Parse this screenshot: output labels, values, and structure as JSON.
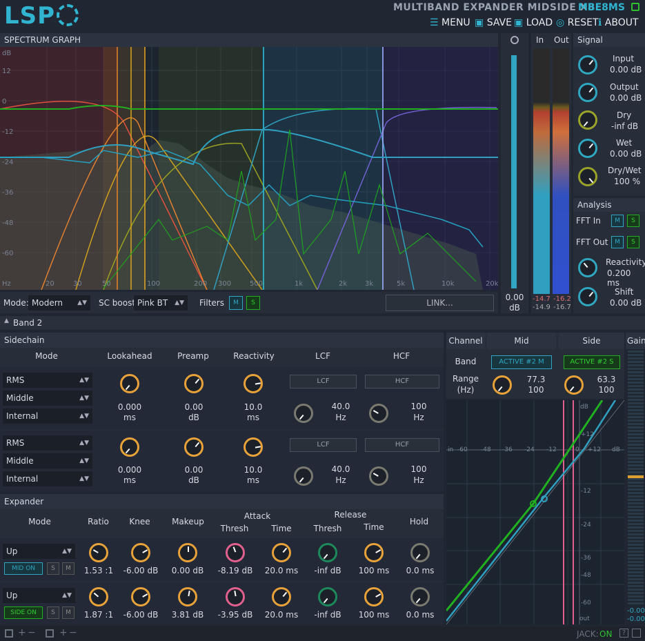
{
  "header": {
    "logo": "LSP",
    "title": "MULTIBAND EXPANDER MIDSIDE X8",
    "short": "MBE8MS",
    "menu": [
      "MENU",
      "SAVE",
      "LOAD",
      "RESET",
      "ABOUT"
    ]
  },
  "spectrum": {
    "title": "SPECTRUM GRAPH",
    "unit": "dB",
    "ylabels": [
      "12",
      "0",
      "-12",
      "-24",
      "-36",
      "-48",
      "-60"
    ],
    "xlabels": [
      "Hz",
      "20",
      "30",
      "50",
      "100",
      "200",
      "300",
      "500",
      "1k",
      "2k",
      "3k",
      "5k",
      "10k",
      "20k"
    ],
    "zoom_value": "0.00",
    "zoom_unit": "dB"
  },
  "meters": {
    "in_label": "In",
    "out_label": "Out",
    "in_vals": [
      "-14.7",
      "-14.9"
    ],
    "out_vals": [
      "-16.2",
      "-16.7"
    ]
  },
  "signal": {
    "title": "Signal",
    "rows": [
      {
        "label": "Input",
        "value": "0.00 dB"
      },
      {
        "label": "Output",
        "value": "0.00 dB"
      },
      {
        "label": "Dry",
        "value": "-inf dB"
      },
      {
        "label": "Wet",
        "value": "0.00 dB"
      },
      {
        "label": "Dry/Wet",
        "value": "100 %"
      }
    ]
  },
  "analysis": {
    "title": "Analysis",
    "fft_in": "FFT In",
    "fft_out": "FFT Out",
    "m": "M",
    "s": "S",
    "reactivity_label": "Reactivity",
    "reactivity_value": "0.200 ms",
    "shift_label": "Shift",
    "shift_value": "0.00 dB"
  },
  "controls": {
    "mode_label": "Mode:",
    "mode_value": "Modern",
    "scboost_label": "SC boost:",
    "scboost_value": "Pink BT",
    "filters_label": "Filters",
    "m": "M",
    "s": "S",
    "link": "LINK..."
  },
  "band": {
    "label": "Band 2"
  },
  "sidechain": {
    "title": "Sidechain",
    "cols": [
      "Mode",
      "Lookahead",
      "Preamp",
      "Reactivity",
      "LCF",
      "HCF"
    ],
    "rows": [
      {
        "mode": "RMS",
        "source": "Middle",
        "type": "Internal",
        "lookahead": "0.000",
        "la_unit": "ms",
        "preamp": "0.00",
        "pre_unit": "dB",
        "react": "10.0",
        "react_unit": "ms",
        "lcf": "LCF",
        "hcf": "HCF",
        "lcf_val": "40.0",
        "lcf_unit": "Hz",
        "hcf_val": "100",
        "hcf_unit": "Hz"
      },
      {
        "mode": "RMS",
        "source": "Middle",
        "type": "Internal",
        "lookahead": "0.000",
        "la_unit": "ms",
        "preamp": "0.00",
        "pre_unit": "dB",
        "react": "10.0",
        "react_unit": "ms",
        "lcf": "LCF",
        "hcf": "HCF",
        "lcf_val": "40.0",
        "lcf_unit": "Hz",
        "hcf_val": "100",
        "hcf_unit": "Hz"
      }
    ]
  },
  "channel": {
    "title": "Channel",
    "mid": "Mid",
    "side": "Side",
    "band_label": "Band",
    "range_label": "Range",
    "range_unit": "(Hz)",
    "mid_btn": "ACTIVE #2 M",
    "side_btn": "ACTIVE #2 S",
    "mid_range": [
      "77.3",
      "100"
    ],
    "side_range": [
      "63.3",
      "100"
    ]
  },
  "gain": {
    "label": "Gain",
    "vals": [
      "-0.00",
      "-0.00"
    ]
  },
  "expander": {
    "title": "Expander",
    "cols": [
      "Mode",
      "Ratio",
      "Knee",
      "Makeup",
      "Attack",
      "Release",
      "Hold"
    ],
    "sub": [
      "Thresh",
      "Time",
      "Thresh",
      "Time"
    ],
    "rows": [
      {
        "mode": "Up",
        "on": "MID ON",
        "s": "S",
        "m": "M",
        "ratio": "1.53 :1",
        "knee": "-6.00 dB",
        "makeup": "0.00 dB",
        "at": "-8.19 dB",
        "atime": "20.0 ms",
        "rt": "-inf dB",
        "rtime": "100 ms",
        "hold": "0.0 ms"
      },
      {
        "mode": "Up",
        "on": "SIDE ON",
        "s": "S",
        "m": "M",
        "ratio": "1.87 :1",
        "knee": "-6.00 dB",
        "makeup": "3.81 dB",
        "at": "-3.95 dB",
        "atime": "20.0 ms",
        "rt": "-inf dB",
        "rtime": "100 ms",
        "hold": "0.0 ms"
      }
    ]
  },
  "curve": {
    "top_label": "dB",
    "in_label": "in",
    "out_label": "out",
    "db_label": "dB",
    "xlabels": [
      "-60",
      "-48",
      "-36",
      "-24",
      "-12",
      "0",
      "+12"
    ],
    "ylabels": [
      "+12",
      "0",
      "-12",
      "-24",
      "-36",
      "-48",
      "-60"
    ]
  },
  "status": {
    "jack_label": "JACK:",
    "jack_value": "ON"
  }
}
